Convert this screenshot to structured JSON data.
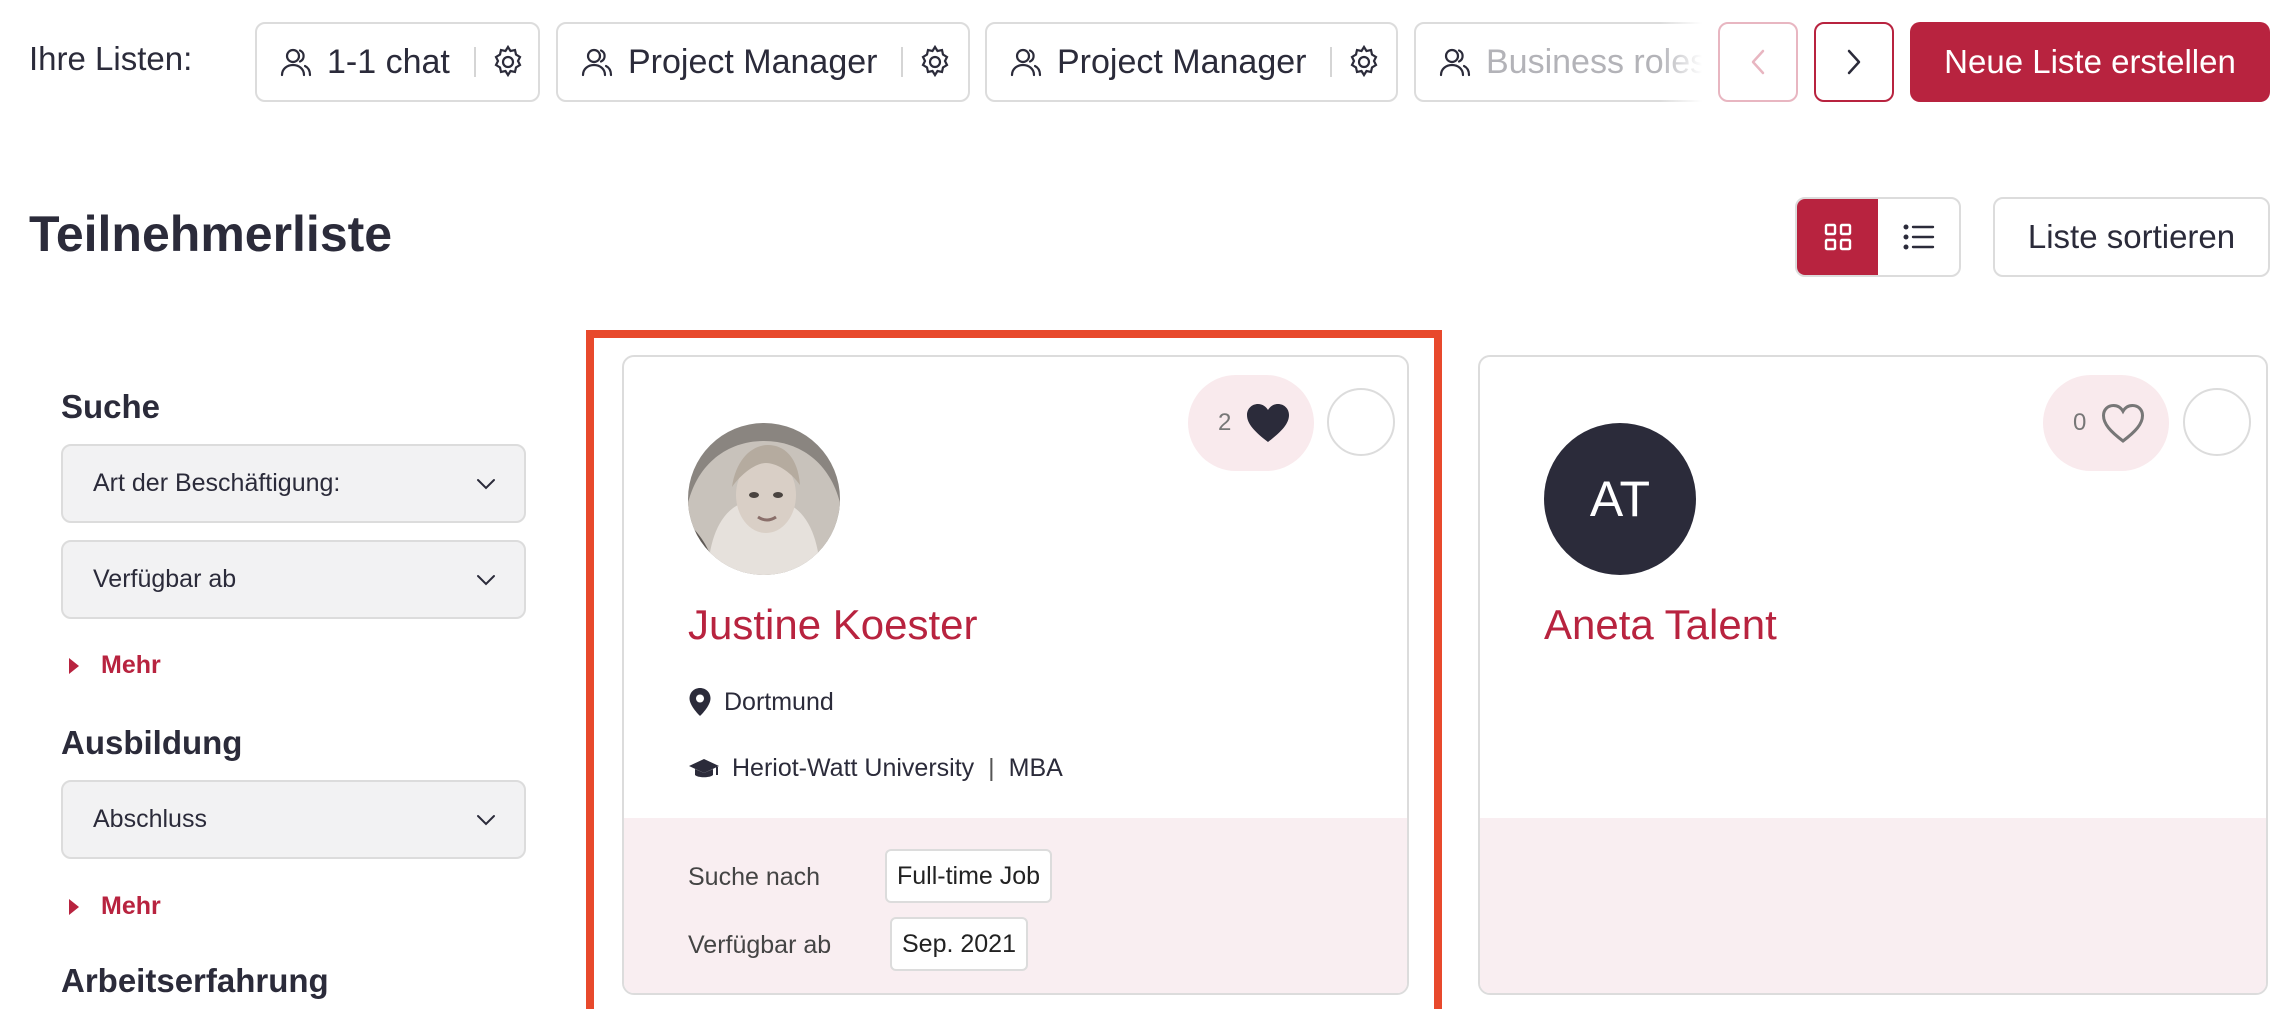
{
  "listbar": {
    "label": "Ihre Listen:",
    "chips": [
      {
        "label": "1-1 chat",
        "icon": "users-icon",
        "settings_icon": "gear-icon"
      },
      {
        "label": "Project Manager",
        "icon": "users-icon",
        "settings_icon": "gear-icon"
      },
      {
        "label": "Project Manager",
        "icon": "users-icon",
        "settings_icon": "gear-icon"
      },
      {
        "label": "Business roles",
        "icon": "users-icon"
      }
    ],
    "prev_icon": "chevron-left-icon",
    "next_icon": "chevron-right-icon",
    "create_button": "Neue Liste erstellen"
  },
  "header": {
    "title": "Teilnehmerliste",
    "grid_view_icon": "grid-icon",
    "list_view_icon": "list-icon",
    "active_view": "grid",
    "sort_button": "Liste sortieren"
  },
  "filters": {
    "search": {
      "heading": "Suche",
      "selects": [
        "Art der Beschäftigung:",
        "Verfügbar ab"
      ],
      "more": "Mehr"
    },
    "education": {
      "heading": "Ausbildung",
      "selects": [
        "Abschluss"
      ],
      "more": "Mehr"
    },
    "experience": {
      "heading": "Arbeitserfahrung"
    }
  },
  "cards": [
    {
      "name": "Justine Koester",
      "likes": "2",
      "liked": true,
      "avatar": "photo",
      "location": "Dortmund",
      "university": "Heriot-Watt University",
      "separator": "|",
      "degree": "MBA",
      "footer": {
        "looking_for_label": "Suche nach",
        "looking_for_value": "Full-time Job",
        "available_label": "Verfügbar ab",
        "available_value": "Sep. 2021"
      }
    },
    {
      "name": "Aneta Talent",
      "likes": "0",
      "liked": false,
      "avatar_initials": "AT"
    }
  ],
  "colors": {
    "accent": "#b8233f",
    "highlight": "#e8492c",
    "text": "#2b2b3a",
    "card_footer": "#f9eef1"
  }
}
